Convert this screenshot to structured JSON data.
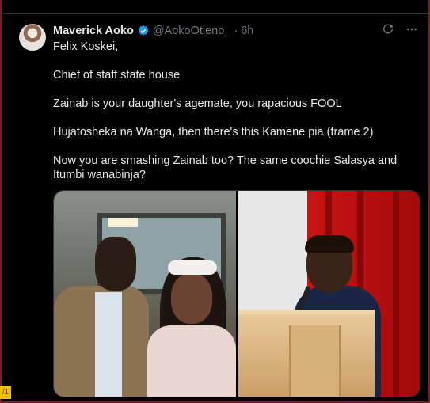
{
  "tweet": {
    "author_name": "Maverick Aoko",
    "handle": "@AokoOtieno_",
    "separator": "·",
    "time": "6h",
    "paragraphs": [
      "Felix Koskei,",
      "Chief of staff state house",
      "Zainab is your daughter's agemate, you rapacious FOOL",
      "Hujatosheka na Wanga, then there's this Kamene pia (frame 2)",
      "Now you are smashing Zainab too? The same coochie Salasya and Itumbi wanabinja?"
    ],
    "icons": {
      "verified": "verified-badge-icon",
      "grok": "grok-icon",
      "more": "more-icon"
    }
  },
  "side_marker": "/1",
  "colors": {
    "background": "#000000",
    "text": "#e7e9ea",
    "muted": "#71767b",
    "verified": "#1d9bf0"
  }
}
